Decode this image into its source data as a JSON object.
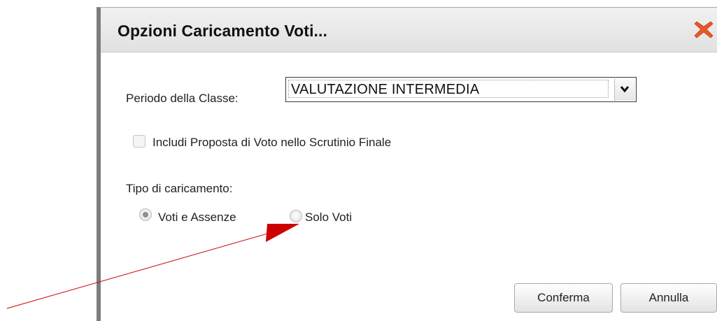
{
  "dialog": {
    "title": "Opzioni Caricamento Voti...",
    "close_icon": "close-icon"
  },
  "period": {
    "label": "Periodo della Classe:",
    "selected": "VALUTAZIONE INTERMEDIA"
  },
  "include_proposal": {
    "label": "Includi Proposta di Voto nello Scrutinio Finale",
    "checked": false,
    "enabled": false
  },
  "load_type": {
    "label": "Tipo di caricamento:",
    "options": [
      {
        "label": "Voti e Assenze",
        "selected": true
      },
      {
        "label": "Solo Voti",
        "selected": false
      }
    ]
  },
  "buttons": {
    "confirm": "Conferma",
    "cancel": "Annulla"
  },
  "annotation": {
    "arrow_color": "#cc0000",
    "points_to": "Solo Voti"
  },
  "colors": {
    "close_icon": "#e8562a",
    "dialog_border": "#7d7d7d"
  }
}
